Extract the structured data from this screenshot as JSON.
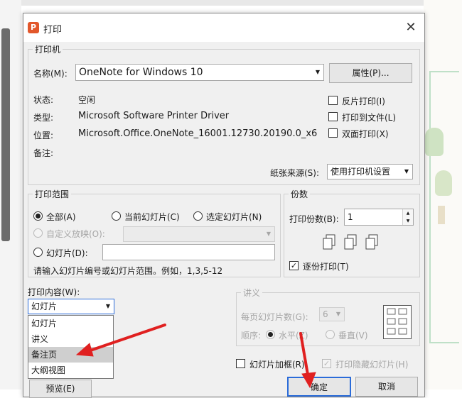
{
  "dialog": {
    "title": "打印",
    "app_icon_letter": "P",
    "close_glyph": "✕"
  },
  "printer": {
    "group_label": "打印机",
    "name_label": "名称(M):",
    "name_value": "OneNote for Windows 10",
    "properties_button": "属性(P)...",
    "status_label": "状态:",
    "status_value": "空闲",
    "type_label": "类型:",
    "type_value": "Microsoft Software Printer Driver",
    "location_label": "位置:",
    "location_value": "Microsoft.Office.OneNote_16001.12730.20190.0_x6",
    "comment_label": "备注:",
    "reverse_print": "反片打印(I)",
    "print_to_file": "打印到文件(L)",
    "duplex": "双面打印(X)",
    "paper_source_label": "纸张来源(S):",
    "paper_source_value": "使用打印机设置"
  },
  "range": {
    "group_label": "打印范围",
    "all": "全部(A)",
    "current_slide": "当前幻灯片(C)",
    "selected_slides": "选定幻灯片(N)",
    "custom_show": "自定义放映(O):",
    "slides": "幻灯片(D):",
    "hint": "请输入幻灯片编号或幻灯片范围。例如，1,3,5-12"
  },
  "copies": {
    "group_label": "份数",
    "count_label": "打印份数(B):",
    "count_value": "1",
    "collate": "逐份打印(T)"
  },
  "content": {
    "label": "打印内容(W):",
    "selected": "幻灯片",
    "options": [
      "幻灯片",
      "讲义",
      "备注页",
      "大纲视图"
    ],
    "highlighted_index": 2
  },
  "handout": {
    "group_label": "讲义",
    "per_page_label": "每页幻灯片数(G):",
    "per_page_value": "6",
    "order_label": "顺序:",
    "horizontal": "水平(Z)",
    "vertical": "垂直(V)"
  },
  "bottom": {
    "frame_slides": "幻灯片加框(R)",
    "print_hidden": "打印隐藏幻灯片(H)",
    "preview_button": "预览(E)",
    "ok_button": "确定",
    "cancel_button": "取消"
  },
  "colors": {
    "annotation_arrow": "#e02020",
    "ok_border": "#2b6cd9"
  }
}
